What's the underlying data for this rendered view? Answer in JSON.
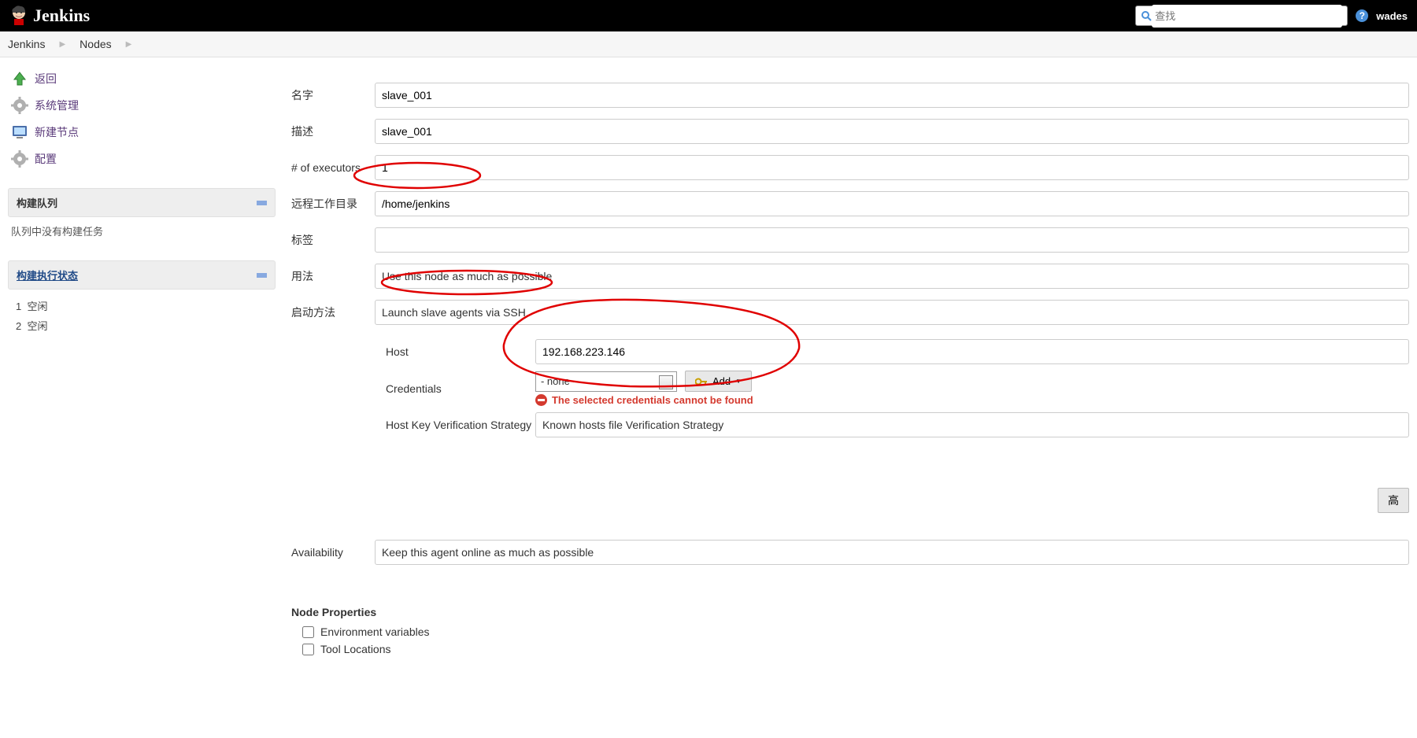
{
  "header": {
    "brand": "Jenkins",
    "search_placeholder": "查找",
    "username": "wades"
  },
  "breadcrumbs": [
    "Jenkins",
    "Nodes"
  ],
  "sidebar": {
    "tasks": [
      {
        "id": "back",
        "label": "返回"
      },
      {
        "id": "manage",
        "label": "系统管理"
      },
      {
        "id": "new-node",
        "label": "新建节点"
      },
      {
        "id": "configure",
        "label": "配置"
      }
    ],
    "queue_title": "构建队列",
    "queue_empty": "队列中没有构建任务",
    "exec_title": "构建执行状态",
    "executors": [
      {
        "num": "1",
        "state": "空闲"
      },
      {
        "num": "2",
        "state": "空闲"
      }
    ]
  },
  "form": {
    "name_label": "名字",
    "name_value": "slave_001",
    "desc_label": "描述",
    "desc_value": "slave_001",
    "executors_label": "# of executors",
    "executors_value": "1",
    "remotefs_label": "远程工作目录",
    "remotefs_value": "/home/jenkins",
    "labels_label": "标签",
    "labels_value": "",
    "usage_label": "用法",
    "usage_value": "Use this node as much as possible",
    "launch_label": "启动方法",
    "launch_value": "Launch slave agents via SSH",
    "host_label": "Host",
    "host_value": "192.168.223.146",
    "cred_label": "Credentials",
    "cred_value": "- none -",
    "add_label": "Add",
    "cred_error": "The selected credentials cannot be found",
    "hostkey_label": "Host Key Verification Strategy",
    "hostkey_value": "Known hosts file Verification Strategy",
    "advanced": "高",
    "availability_label": "Availability",
    "availability_value": "Keep this agent online as much as possible",
    "node_props_title": "Node Properties",
    "np_env": "Environment variables",
    "np_tool": "Tool Locations"
  }
}
